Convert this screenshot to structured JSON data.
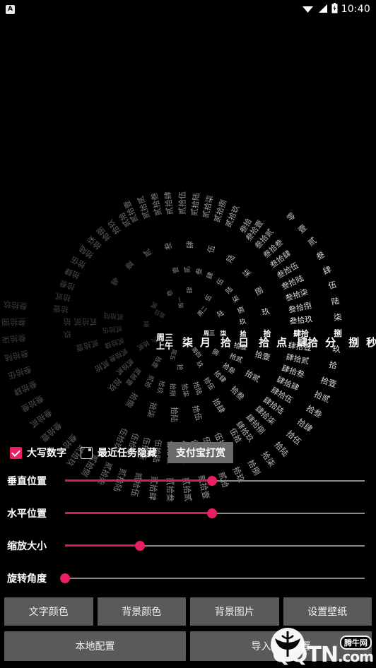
{
  "statusbar": {
    "app_icon": "app-badge-icon",
    "badge_letter": "A",
    "wifi_icon": "wifi-icon",
    "signal_icon": "cellular-signal-icon",
    "battery_icon": "battery-charging-icon",
    "clock": "10:40"
  },
  "clock": {
    "center_week": "周三",
    "center_ampm": "上午",
    "center_tokens": [
      "柒",
      "月",
      "拾",
      "日",
      "拾",
      "点",
      "肆拾",
      "分",
      "捌",
      "秒"
    ],
    "month_value": "柒",
    "day_value": "拾",
    "hour_value": "拾",
    "minute_value": "肆拾",
    "second_value": "捌",
    "text_color": "#ffffff",
    "rings": {
      "seconds_ring": {
        "selected": "捌",
        "labels": [
          "零",
          "壹",
          "贰",
          "叁",
          "肆",
          "伍",
          "陆",
          "柒",
          "捌",
          "玖",
          "拾",
          "拾壹",
          "拾贰",
          "拾叁",
          "拾肆",
          "拾伍",
          "拾陆",
          "拾柒",
          "拾捌",
          "拾玖",
          "贰拾",
          "贰拾壹",
          "贰拾贰",
          "贰拾叁",
          "贰拾肆",
          "贰拾伍",
          "贰拾陆",
          "贰拾柒",
          "贰拾捌",
          "贰拾玖",
          "叁拾",
          "叁拾壹",
          "叁拾贰",
          "叁拾叁",
          "叁拾肆",
          "叁拾伍",
          "叁拾陆",
          "叁拾柒",
          "叁拾捌",
          "叁拾玖",
          "肆拾",
          "肆拾壹",
          "肆拾贰",
          "肆拾叁",
          "肆拾肆",
          "肆拾伍",
          "肆拾陆",
          "肆拾柒",
          "肆拾捌",
          "肆拾玖",
          "伍拾",
          "伍拾壹",
          "伍拾贰",
          "伍拾叁",
          "伍拾肆",
          "伍拾伍",
          "伍拾陆",
          "伍拾柒",
          "伍拾捌",
          "伍拾玖"
        ]
      },
      "minutes_ring": {
        "selected": "肆拾",
        "labels": [
          "零",
          "壹",
          "贰",
          "叁",
          "肆",
          "伍",
          "陆",
          "柒",
          "捌",
          "玖",
          "拾",
          "拾壹",
          "拾贰",
          "拾叁",
          "拾肆",
          "拾伍",
          "拾陆",
          "拾柒",
          "拾捌",
          "拾玖",
          "贰拾",
          "贰拾壹",
          "贰拾贰",
          "贰拾叁",
          "贰拾肆",
          "贰拾伍",
          "贰拾陆",
          "贰拾柒",
          "贰拾捌",
          "贰拾玖",
          "叁拾",
          "叁拾壹",
          "叁拾贰",
          "叁拾叁",
          "叁拾肆",
          "叁拾伍",
          "叁拾陆",
          "叁拾柒",
          "叁拾捌",
          "叁拾玖",
          "肆拾",
          "肆拾壹",
          "肆拾贰",
          "肆拾叁",
          "肆拾肆",
          "肆拾伍",
          "肆拾陆",
          "肆拾柒",
          "肆拾捌",
          "肆拾玖",
          "伍拾",
          "伍拾壹",
          "伍拾贰",
          "伍拾叁",
          "伍拾肆",
          "伍拾伍",
          "伍拾陆",
          "伍拾柒",
          "伍拾捌",
          "伍拾玖"
        ]
      },
      "hours_ring": {
        "selected": "拾",
        "labels": [
          "零",
          "壹",
          "贰",
          "叁",
          "肆",
          "伍",
          "陆",
          "柒",
          "捌",
          "玖",
          "拾",
          "拾壹",
          "拾贰",
          "拾叁",
          "拾肆",
          "拾伍",
          "拾陆",
          "拾柒",
          "拾捌",
          "拾玖",
          "贰拾",
          "贰拾壹",
          "贰拾贰",
          "贰拾叁"
        ]
      },
      "days_ring": {
        "selected": "拾",
        "labels": [
          "壹",
          "贰",
          "叁",
          "肆",
          "伍",
          "陆",
          "柒",
          "捌",
          "玖",
          "拾",
          "拾壹",
          "拾贰",
          "拾叁",
          "拾肆",
          "拾伍",
          "拾陆",
          "拾柒",
          "拾捌",
          "拾玖",
          "贰拾",
          "贰拾壹",
          "贰拾贰",
          "贰拾叁",
          "贰拾肆",
          "贰拾伍",
          "贰拾陆",
          "贰拾柒",
          "贰拾捌",
          "贰拾玖",
          "叁拾",
          "叁拾壹"
        ]
      },
      "months_ring": {
        "selected": "柒",
        "labels": [
          "壹",
          "贰",
          "叁",
          "肆",
          "伍",
          "陆",
          "柒",
          "捌",
          "玖",
          "拾",
          "拾壹",
          "拾贰"
        ]
      },
      "week_ring": {
        "selected": "周三",
        "labels": [
          "周日",
          "周一",
          "周二",
          "周三",
          "周四",
          "周五",
          "周六"
        ]
      },
      "ampm_ring": {
        "selected": "上午",
        "labels": [
          "上午",
          "下午"
        ]
      }
    }
  },
  "options": {
    "uppercase_numbers": {
      "label": "大写数字",
      "checked": true
    },
    "hide_recent_tasks": {
      "label": "最近任务隐藏",
      "checked": false
    },
    "donate_button": "支付宝打赏"
  },
  "sliders": [
    {
      "label": "垂直位置",
      "value": 49,
      "name": "vertical-position"
    },
    {
      "label": "水平位置",
      "value": 49,
      "name": "horizontal-position"
    },
    {
      "label": "缩放大小",
      "value": 25,
      "name": "scale-size"
    },
    {
      "label": "旋转角度",
      "value": 0,
      "name": "rotation-angle"
    }
  ],
  "buttons_row1": [
    "文字颜色",
    "背景颜色",
    "背景图片",
    "设置壁纸"
  ],
  "buttons_row2": [
    "本地配置",
    "导入网络配置"
  ],
  "watermark": {
    "site": "QQTN",
    "suffix": ".com",
    "badge": "腾牛网"
  },
  "colors": {
    "accent": "#e91e63",
    "accent_fill": "#d81b60",
    "background": "#000000",
    "button_gray": "#5a5a5a",
    "donate_gray": "#6b6b6b",
    "text": "#ffffff",
    "track": "#8a8a8a"
  }
}
